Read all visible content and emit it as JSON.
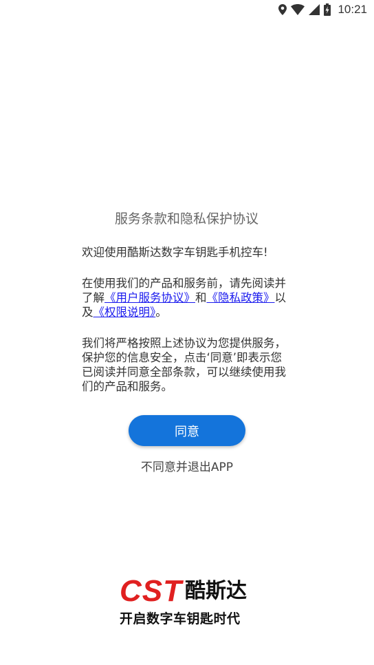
{
  "status_bar": {
    "time": "10:21",
    "icons": [
      "location-icon",
      "wifi-icon",
      "signal-icon",
      "battery-charging-icon"
    ]
  },
  "dialog": {
    "title": "服务条款和隐私保护协议",
    "welcome": "欢迎使用酷斯达数字车钥匙手机控车!",
    "intro_prefix": "在使用我们的产品和服务前，请先阅读并了解",
    "link_user_agreement": "《用户服务协议》",
    "intro_and": "和",
    "link_privacy": "《隐私政策》",
    "intro_also": "以及",
    "link_permissions": "《权限说明》",
    "intro_end": "。",
    "commitment": "我们将严格按照上述协议为您提供服务，保护您的信息安全，点击‘同意’即表示您已阅读并同意全部条款，可以继续使用我们的产品和服务。"
  },
  "actions": {
    "agree_label": "同意",
    "disagree_label": "不同意并退出APP"
  },
  "logo": {
    "brand_latin": "CST",
    "brand_cn": "酷斯达",
    "slogan": "开启数字车钥匙时代"
  },
  "colors": {
    "primary": "#1474db",
    "link": "#1a1aee",
    "brand_red": "#e02020"
  }
}
